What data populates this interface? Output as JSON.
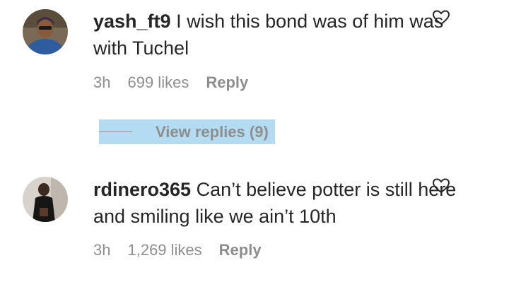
{
  "comments": [
    {
      "username": "yash_ft9",
      "text": "I wish this bond was of him was with Tuchel",
      "time": "3h",
      "likes": "699 likes",
      "reply_label": "Reply",
      "icons": {
        "avatar": "profile-photo",
        "like": "heart-outline-icon"
      }
    },
    {
      "username": "rdinero365",
      "text": "Can’t believe potter is still here and smiling like we ain’t 10th",
      "time": "3h",
      "likes": "1,269 likes",
      "reply_label": "Reply",
      "icons": {
        "avatar": "profile-photo",
        "like": "heart-outline-icon"
      }
    }
  ],
  "view_replies": {
    "label": "View replies (9)",
    "highlight_color": "#b3dcf3"
  },
  "colors": {
    "text": "#262626",
    "muted": "#8e8e8e",
    "background": "#ffffff"
  }
}
